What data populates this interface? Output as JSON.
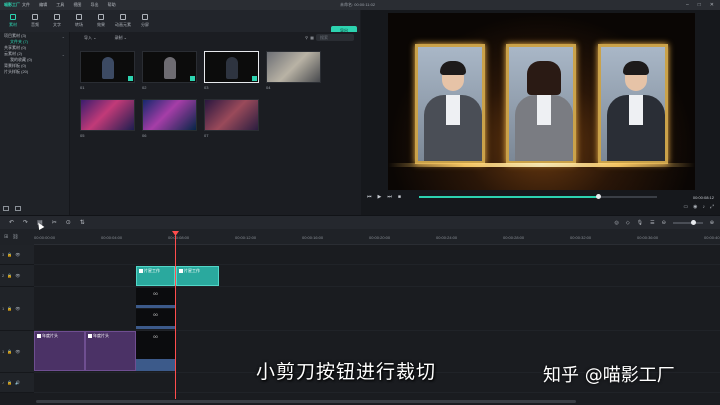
{
  "titlebar": {
    "app_name": "喵影工厂",
    "menu": [
      "文件",
      "编辑",
      "工具",
      "视图",
      "导出",
      "帮助"
    ],
    "doc_title": "未命名: 00:00:11:02"
  },
  "tabs": [
    {
      "label": "素材"
    },
    {
      "label": "音频"
    },
    {
      "label": "文字"
    },
    {
      "label": "转场"
    },
    {
      "label": "效果"
    },
    {
      "label": "动画元素"
    },
    {
      "label": "分屏"
    }
  ],
  "export_label": "导出",
  "sidebar": {
    "items": [
      {
        "label": "项目素材 (3)",
        "sub": false,
        "active": false
      },
      {
        "label": "文件夹 (7)",
        "sub": true,
        "active": true
      },
      {
        "label": "共享素材 (0)",
        "sub": false,
        "active": false
      },
      {
        "label": "云素材 (2)",
        "sub": false,
        "active": false
      },
      {
        "label": "我的收藏 (0)",
        "sub": true,
        "active": false
      },
      {
        "label": "背景样板 (0)",
        "sub": false,
        "active": false
      },
      {
        "label": "片头样板 (20)",
        "sub": false,
        "active": false
      }
    ]
  },
  "media": {
    "import_label": "导入",
    "record_label": "录制",
    "search_placeholder": "搜索",
    "thumbs": [
      {
        "label": "01",
        "kind": "portrait",
        "checked": true
      },
      {
        "label": "02",
        "kind": "portrait",
        "checked": true
      },
      {
        "label": "03",
        "kind": "portrait",
        "checked": true
      },
      {
        "label": "04",
        "kind": "meeting",
        "checked": false
      },
      {
        "label": "05",
        "kind": "concert",
        "checked": false
      },
      {
        "label": "06",
        "kind": "concert",
        "checked": false
      },
      {
        "label": "07",
        "kind": "concert2",
        "checked": false
      }
    ]
  },
  "preview": {
    "timecode": "00:00:08:12",
    "progress": 0.75,
    "controls": [
      "⏮",
      "▶",
      "⏭",
      "■"
    ]
  },
  "timeline": {
    "ruler_ticks": [
      "00:00:00:00",
      "00:00:04:00",
      "00:00:08:00",
      "00:00:12:00",
      "00:00:16:00",
      "00:00:20:00",
      "00:00:24:00",
      "00:00:28:00",
      "00:00:32:00",
      "00:00:36:00",
      "00:00:40:00"
    ],
    "tracks": [
      {
        "label": "3"
      },
      {
        "label": "2"
      },
      {
        "label": "1"
      },
      {
        "label": "1"
      }
    ],
    "clips": {
      "title_a": "片星工作",
      "title_b": "片星工作",
      "vid_a": "00",
      "vid_b": "00",
      "vid_c": "00",
      "purple_a": "年度片头",
      "purple_b": "年度片头"
    }
  },
  "overlay": {
    "subtitle": "小剪刀按钮进行裁切",
    "watermark": "知乎 @喵影工厂"
  },
  "colors": {
    "accent": "#2dd3b0",
    "playhead": "#ff4d4d",
    "title_clip": "#2aa99e",
    "purple_clip": "#4b3266"
  }
}
